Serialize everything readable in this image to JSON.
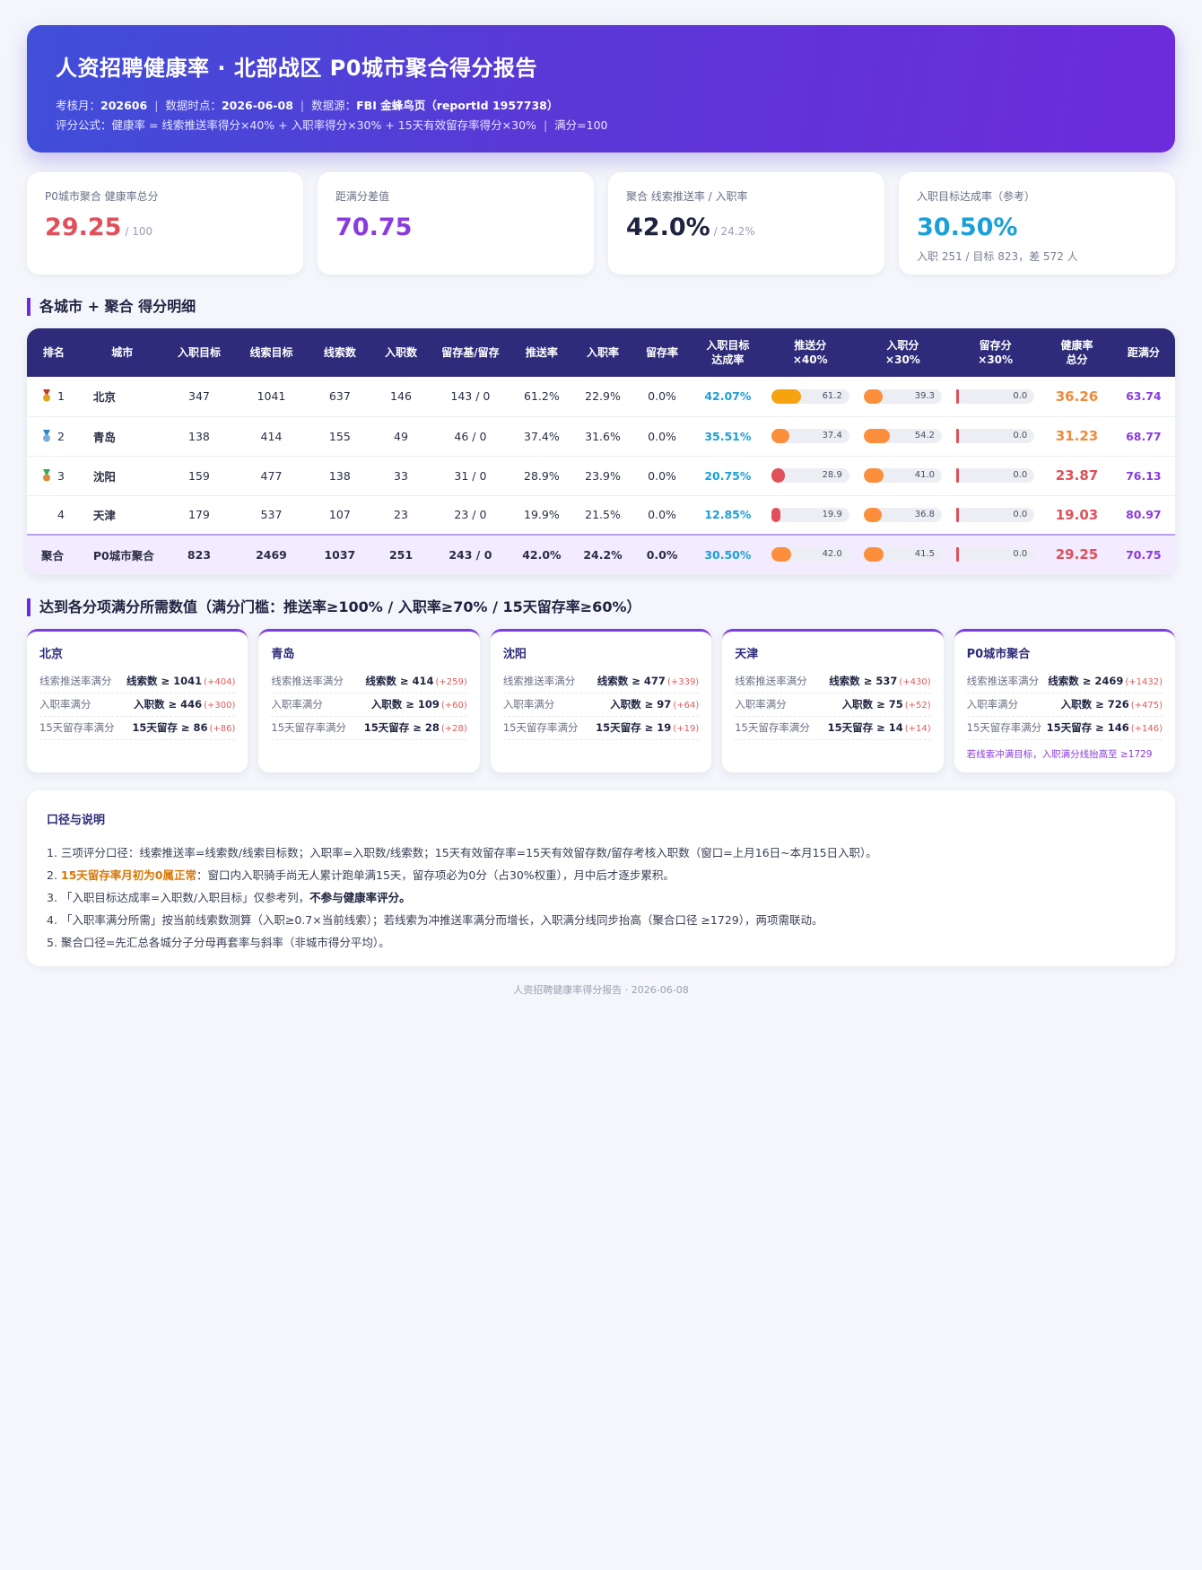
{
  "header": {
    "title": "人资招聘健康率 · 北部战区 P0城市聚合得分报告",
    "meta1": [
      {
        "k": "考核月：",
        "v": "202606"
      },
      {
        "k": "数据时点：",
        "v": "2026-06-08"
      },
      {
        "k": "数据源：",
        "v": "FBI 金蜂鸟页（reportId 1957738）"
      }
    ],
    "formula": "评分公式：健康率 = 线索推送率得分×40% + 入职率得分×30% + 15天有效留存率得分×30%",
    "full": "满分=100"
  },
  "kpis": [
    {
      "label": "P0城市聚合 健康率总分",
      "value": "29.25",
      "suffix": "/ 100",
      "color": "#e0505a",
      "sub": ""
    },
    {
      "label": "距满分差值",
      "value": "70.75",
      "suffix": "",
      "color": "#8a3be0",
      "sub": ""
    },
    {
      "label": "聚合 线索推送率 / 入职率",
      "value": "42.0%",
      "suffix": "/ 24.2%",
      "color": "#1f2340",
      "sub": ""
    },
    {
      "label": "入职目标达成率（参考）",
      "value": "30.50%",
      "suffix": "",
      "color": "#1aa0d8",
      "sub": "入职 251 / 目标 823，差 572 人"
    }
  ],
  "table_title": "各城市 + 聚合 得分明细",
  "columns": [
    "排名",
    "城市",
    "入职目标",
    "线索目标",
    "线索数",
    "入职数",
    "留存基/留存",
    "推送率",
    "入职率",
    "留存率",
    "入职目标|达成率",
    "推送分|×40%",
    "入职分|×30%",
    "留存分|×30%",
    "健康率|总分",
    "距满分"
  ],
  "rows": [
    {
      "rank": "1",
      "medal": "gold",
      "city": "北京",
      "hire_target": "347",
      "lead_target": "1041",
      "leads": "637",
      "hires": "146",
      "retention": "143 / 0",
      "push_rate": "61.2%",
      "hire_rate": "22.9%",
      "ret_rate": "0.0%",
      "achieve": "42.07%",
      "push_score": 61.2,
      "hire_score": 39.3,
      "ret_score": 0.0,
      "total": "36.26",
      "total_color": "#f08a3a",
      "gap": "63.74",
      "push_color": "#f5a30f"
    },
    {
      "rank": "2",
      "medal": "silver",
      "city": "青岛",
      "hire_target": "138",
      "lead_target": "414",
      "leads": "155",
      "hires": "49",
      "retention": "46 / 0",
      "push_rate": "37.4%",
      "hire_rate": "31.6%",
      "ret_rate": "0.0%",
      "achieve": "35.51%",
      "push_score": 37.4,
      "hire_score": 54.2,
      "ret_score": 0.0,
      "total": "31.23",
      "total_color": "#f08a3a",
      "gap": "68.77",
      "push_color": "#fb8f3c"
    },
    {
      "rank": "3",
      "medal": "bronze",
      "city": "沈阳",
      "hire_target": "159",
      "lead_target": "477",
      "leads": "138",
      "hires": "33",
      "retention": "31 / 0",
      "push_rate": "28.9%",
      "hire_rate": "23.9%",
      "ret_rate": "0.0%",
      "achieve": "20.75%",
      "push_score": 28.9,
      "hire_score": 41.0,
      "ret_score": 0.0,
      "total": "23.87",
      "total_color": "#e0505a",
      "gap": "76.13",
      "push_color": "#e0505a"
    },
    {
      "rank": "4",
      "medal": "",
      "city": "天津",
      "hire_target": "179",
      "lead_target": "537",
      "leads": "107",
      "hires": "23",
      "retention": "23 / 0",
      "push_rate": "19.9%",
      "hire_rate": "21.5%",
      "ret_rate": "0.0%",
      "achieve": "12.85%",
      "push_score": 19.9,
      "hire_score": 36.8,
      "ret_score": 0.0,
      "total": "19.03",
      "total_color": "#e0505a",
      "gap": "80.97",
      "push_color": "#e0505a"
    },
    {
      "rank": "聚合",
      "medal": "",
      "city": "P0城市聚合",
      "hire_target": "823",
      "lead_target": "2469",
      "leads": "1037",
      "hires": "251",
      "retention": "243 / 0",
      "push_rate": "42.0%",
      "hire_rate": "24.2%",
      "ret_rate": "0.0%",
      "achieve": "30.50%",
      "push_score": 42.0,
      "hire_score": 41.5,
      "ret_score": 0.0,
      "total": "29.25",
      "total_color": "#e0505a",
      "gap": "70.75",
      "push_color": "#fb8f3c",
      "agg": true
    }
  ],
  "hire_bar_color": "#fb8f3c",
  "cards_title": "达到各分项满分所需数值（满分门槛：推送率≥100% / 入职率≥70% / 15天留存率≥60%）",
  "cards": [
    {
      "city": "北京",
      "rows": [
        {
          "k": "线索推送率满分",
          "v": "线索数 ≥ 1041",
          "d": "(+404)"
        },
        {
          "k": "入职率满分",
          "v": "入职数 ≥ 446",
          "d": "(+300)"
        },
        {
          "k": "15天留存率满分",
          "v": "15天留存 ≥ 86",
          "d": "(+86)"
        }
      ],
      "note": ""
    },
    {
      "city": "青岛",
      "rows": [
        {
          "k": "线索推送率满分",
          "v": "线索数 ≥ 414",
          "d": "(+259)"
        },
        {
          "k": "入职率满分",
          "v": "入职数 ≥ 109",
          "d": "(+60)"
        },
        {
          "k": "15天留存率满分",
          "v": "15天留存 ≥ 28",
          "d": "(+28)"
        }
      ],
      "note": ""
    },
    {
      "city": "沈阳",
      "rows": [
        {
          "k": "线索推送率满分",
          "v": "线索数 ≥ 477",
          "d": "(+339)"
        },
        {
          "k": "入职率满分",
          "v": "入职数 ≥ 97",
          "d": "(+64)"
        },
        {
          "k": "15天留存率满分",
          "v": "15天留存 ≥ 19",
          "d": "(+19)"
        }
      ],
      "note": ""
    },
    {
      "city": "天津",
      "rows": [
        {
          "k": "线索推送率满分",
          "v": "线索数 ≥ 537",
          "d": "(+430)"
        },
        {
          "k": "入职率满分",
          "v": "入职数 ≥ 75",
          "d": "(+52)"
        },
        {
          "k": "15天留存率满分",
          "v": "15天留存 ≥ 14",
          "d": "(+14)"
        }
      ],
      "note": ""
    },
    {
      "city": "P0城市聚合",
      "rows": [
        {
          "k": "线索推送率满分",
          "v": "线索数 ≥ 2469",
          "d": "(+1432)"
        },
        {
          "k": "入职率满分",
          "v": "入职数 ≥ 726",
          "d": "(+475)"
        },
        {
          "k": "15天留存率满分",
          "v": "15天留存 ≥ 146",
          "d": "(+146)"
        }
      ],
      "note": "若线索冲满目标，入职满分线抬高至 ≥1729"
    }
  ],
  "notes": {
    "title": "口径与说明",
    "items": [
      {
        "pre": "1. 三项评分口径：线索推送率=线索数/线索目标数；入职率=入职数/线索数；15天有效留存率=15天有效留存数/留存考核入职数（窗口=上月16日~本月15日入职）。",
        "hl": "",
        "post": "",
        "bold": ""
      },
      {
        "pre": "2. ",
        "hl": "15天留存率月初为0属正常",
        "post": "：窗口内入职骑手尚无人累计跑单满15天，留存项必为0分（占30%权重），月中后才逐步累积。",
        "bold": ""
      },
      {
        "pre": "3. 「入职目标达成率=入职数/入职目标」仅参考列，",
        "hl": "",
        "post": "",
        "bold": "不参与健康率评分。"
      },
      {
        "pre": "4. 「入职率满分所需」按当前线索数测算（入职≥0.7×当前线索）；若线索为冲推送率满分而增长，入职满分线同步抬高（聚合口径 ≥1729），两项需联动。",
        "hl": "",
        "post": "",
        "bold": ""
      },
      {
        "pre": "5. 聚合口径=先汇总各城分子分母再套率与斜率（非城市得分平均）。",
        "hl": "",
        "post": "",
        "bold": ""
      }
    ]
  },
  "footer": "人资招聘健康率得分报告 · 2026-06-08"
}
